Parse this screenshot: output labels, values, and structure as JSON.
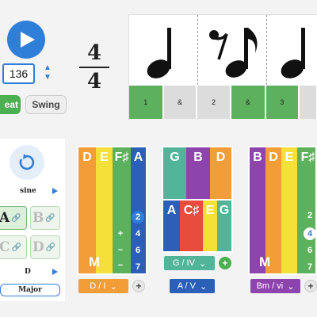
{
  "transport": {
    "tempo": "136",
    "time_signature": {
      "numerator": "4",
      "denominator": "4"
    },
    "straight_label": "eat",
    "swing_label": "Swing"
  },
  "rhythm": {
    "beats": [
      "1",
      "&",
      "2",
      "&",
      "3",
      ""
    ],
    "beat_active": [
      true,
      false,
      false,
      true,
      true,
      false
    ]
  },
  "controls": {
    "sound_label": "sine",
    "key_buttons": [
      {
        "note": "A",
        "active": true
      },
      {
        "note": "B",
        "active": false
      },
      {
        "note": "C",
        "active": false
      },
      {
        "note": "D",
        "active": false
      }
    ],
    "root_label": "D",
    "scale_label": "Major"
  },
  "chords": {
    "card1": {
      "notes": [
        "D",
        "E",
        "F♯",
        "A"
      ],
      "degrees": [
        "2",
        "4",
        "6",
        "7"
      ],
      "marks": [
        "+",
        "~",
        "−"
      ],
      "quality": "M",
      "select": "D / I",
      "colors": [
        "#f29d38",
        "#f5e03a",
        "#5eb15c",
        "#2b5fb8"
      ]
    },
    "card2": {
      "top_notes": [
        "G",
        "B",
        "D"
      ],
      "bottom_notes": [
        "A",
        "C♯",
        "E",
        "G"
      ],
      "top_select": "G / IV",
      "bottom_select": "A / V"
    },
    "card3": {
      "notes": [
        "B",
        "D",
        "E",
        "F♯"
      ],
      "degrees": [
        "2",
        "4",
        "6",
        "7"
      ],
      "quality": "M",
      "select": "Bm / vi"
    }
  }
}
